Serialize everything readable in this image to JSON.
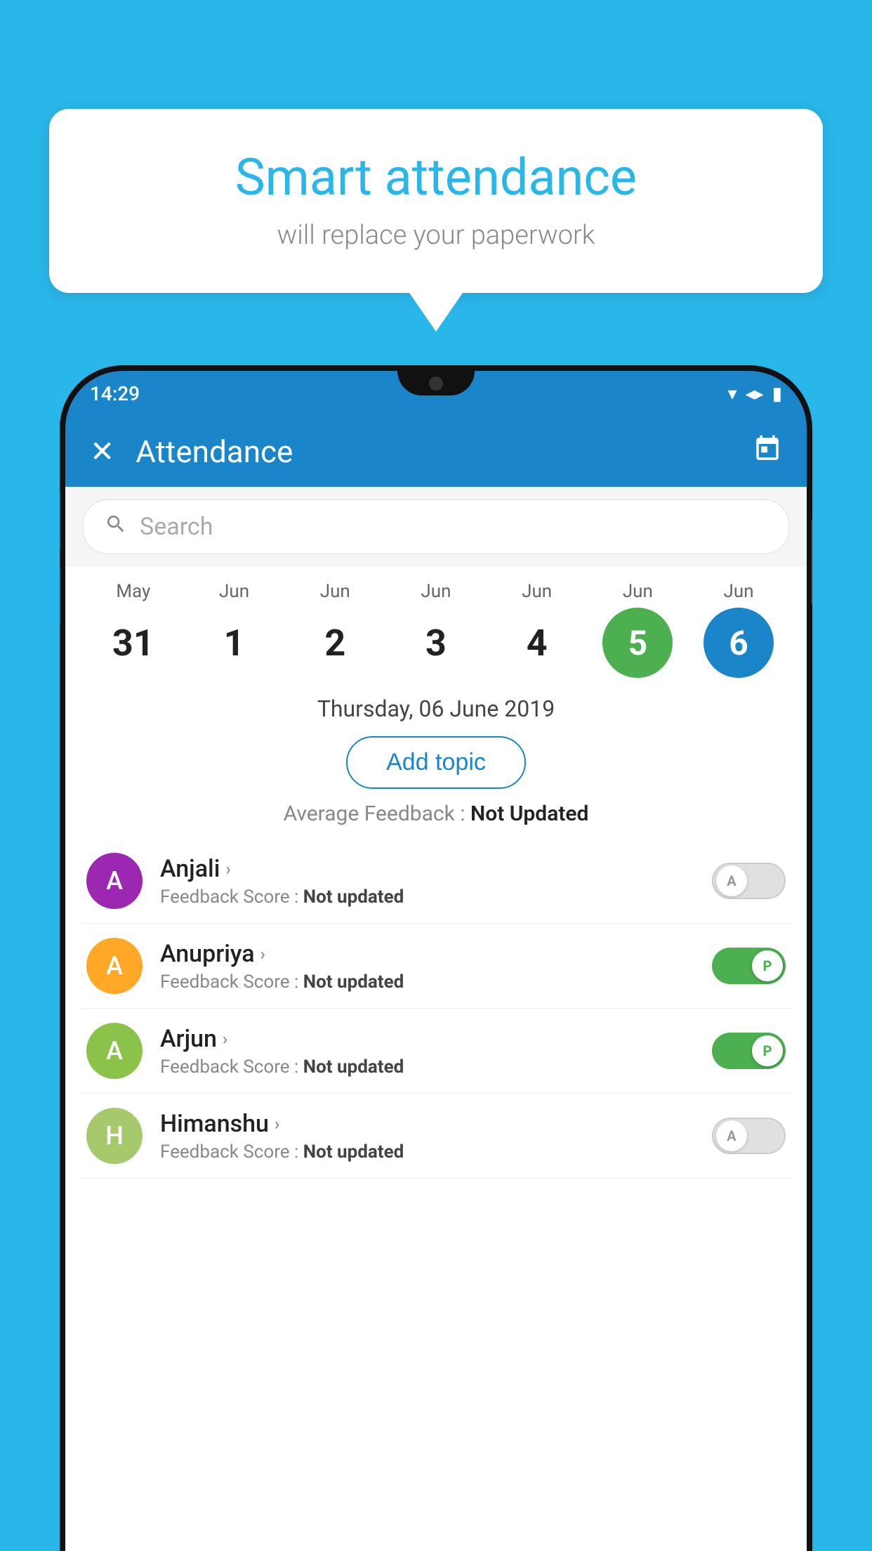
{
  "background_color": "#29b6e8",
  "speech_bubble": {
    "title": "Smart attendance",
    "subtitle": "will replace your paperwork"
  },
  "status_bar": {
    "time": "14:29",
    "wifi_icon": "▼",
    "signal_icon": "▲",
    "battery_icon": "▮"
  },
  "app_bar": {
    "title": "Attendance",
    "close_label": "✕",
    "calendar_icon": "📅"
  },
  "search": {
    "placeholder": "Search"
  },
  "calendar": {
    "days": [
      {
        "month": "May",
        "date": "31",
        "type": "normal"
      },
      {
        "month": "Jun",
        "date": "1",
        "type": "normal"
      },
      {
        "month": "Jun",
        "date": "2",
        "type": "normal"
      },
      {
        "month": "Jun",
        "date": "3",
        "type": "normal"
      },
      {
        "month": "Jun",
        "date": "4",
        "type": "normal"
      },
      {
        "month": "Jun",
        "date": "5",
        "type": "today"
      },
      {
        "month": "Jun",
        "date": "6",
        "type": "selected"
      }
    ]
  },
  "selected_date": "Thursday, 06 June 2019",
  "add_topic_label": "Add topic",
  "average_feedback": {
    "label": "Average Feedback : ",
    "value": "Not Updated"
  },
  "students": [
    {
      "name": "Anjali",
      "avatar_letter": "A",
      "avatar_color": "#9c27b0",
      "feedback": "Not updated",
      "attendance": "absent",
      "toggle_label": "A"
    },
    {
      "name": "Anupriya",
      "avatar_letter": "A",
      "avatar_color": "#ffa726",
      "feedback": "Not updated",
      "attendance": "present",
      "toggle_label": "P"
    },
    {
      "name": "Arjun",
      "avatar_letter": "A",
      "avatar_color": "#8bc34a",
      "feedback": "Not updated",
      "attendance": "present",
      "toggle_label": "P"
    },
    {
      "name": "Himanshu",
      "avatar_letter": "H",
      "avatar_color": "#a5c96b",
      "feedback": "Not updated",
      "attendance": "absent",
      "toggle_label": "A"
    }
  ]
}
